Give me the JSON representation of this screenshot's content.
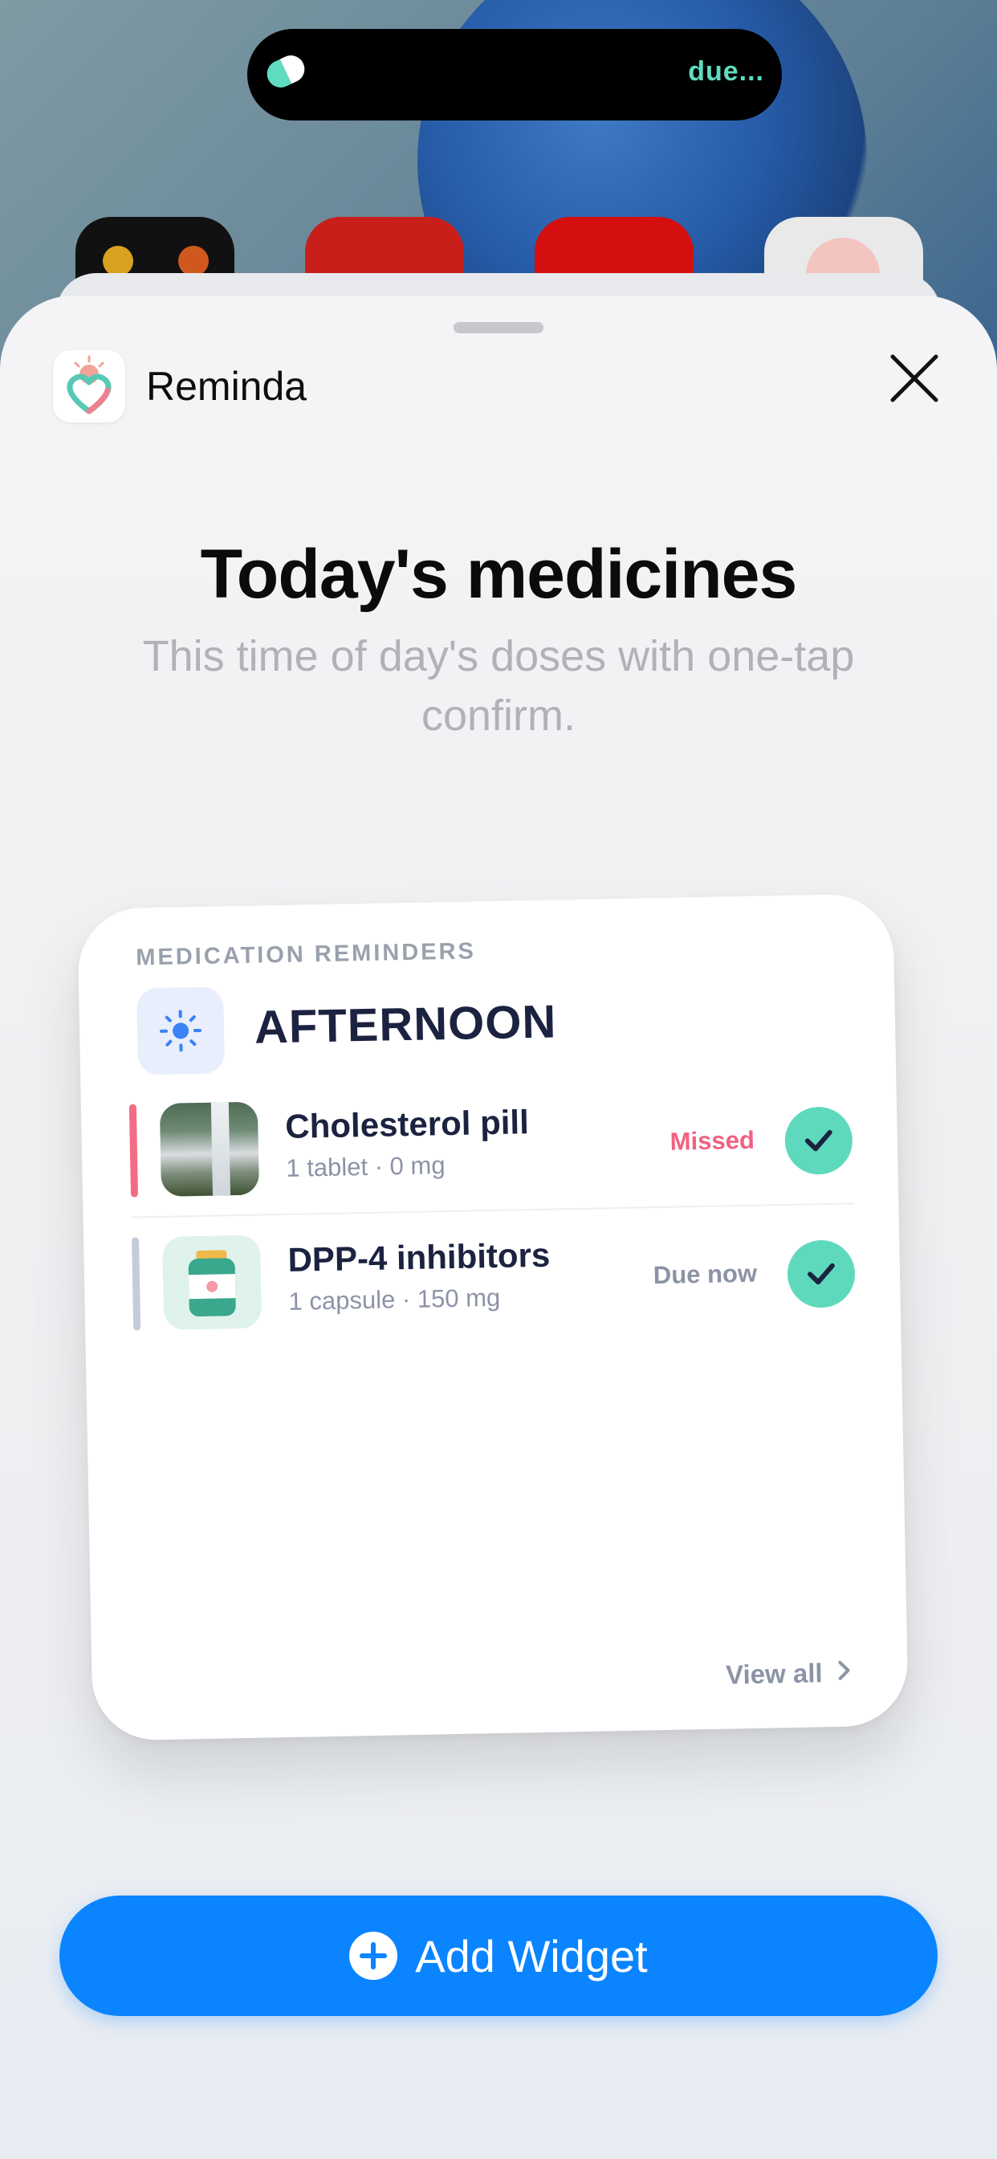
{
  "status_bar": {
    "island_text": "due..."
  },
  "sheet": {
    "app_name": "Reminda",
    "title": "Today's medicines",
    "subtitle": "This time of day's doses with one-tap confirm."
  },
  "widget": {
    "caption": "MEDICATION REMINDERS",
    "period": "AFTERNOON",
    "medications": [
      {
        "name": "Cholesterol pill",
        "dose": "1 tablet · 0 mg",
        "status": "Missed",
        "status_color": "#f06180"
      },
      {
        "name": "DPP-4 inhibitors",
        "dose": "1 capsule · 150 mg",
        "status": "Due now",
        "status_color": "#8c93a6"
      }
    ],
    "view_all_label": "View all"
  },
  "add_widget_button": {
    "label": "Add Widget"
  },
  "colors": {
    "accent_blue": "#0a84ff",
    "check_green": "#5fd9bd",
    "missed_pink": "#f06180",
    "navy_text": "#1c2340"
  }
}
